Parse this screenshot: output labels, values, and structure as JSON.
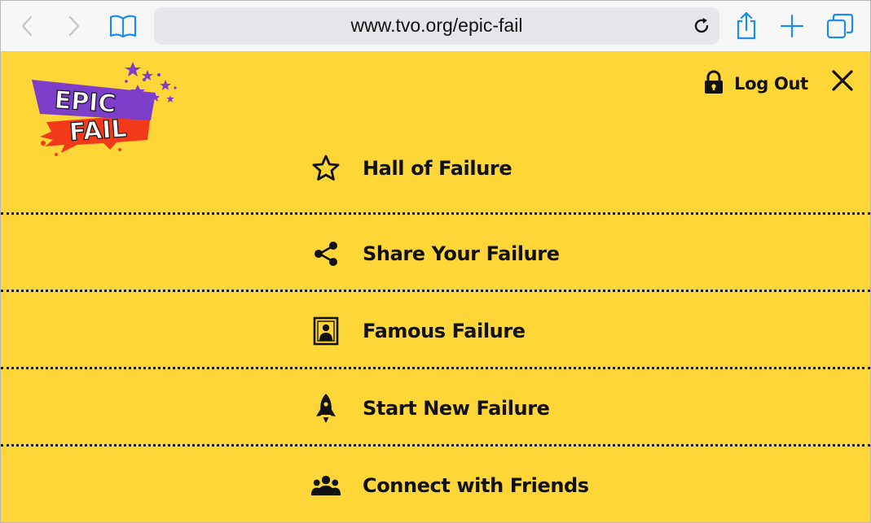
{
  "browser": {
    "url": "www.tvo.org/epic-fail",
    "back_icon": "chevron-left-icon",
    "forward_icon": "chevron-right-icon",
    "bookmarks_icon": "book-icon",
    "reload_icon": "reload-icon",
    "share_icon": "share-icon",
    "new_tab_icon": "plus-icon",
    "tabs_icon": "tabs-icon"
  },
  "header": {
    "logo_line1": "EPIC",
    "logo_line2": "FAIL",
    "logout_label": "Log Out",
    "logout_icon": "lock-icon",
    "close_icon": "close-icon"
  },
  "menu": {
    "items": [
      {
        "label": "Hall of Failure",
        "icon": "star-icon"
      },
      {
        "label": "Share Your Failure",
        "icon": "share-icon"
      },
      {
        "label": "Famous Failure",
        "icon": "portrait-icon"
      },
      {
        "label": "Start New Failure",
        "icon": "rocket-icon"
      },
      {
        "label": "Connect with Friends",
        "icon": "group-icon"
      }
    ]
  },
  "colors": {
    "page_background": "#fed638",
    "toolbar_background": "#f7f7f7",
    "toolbar_accent": "#1a8cf0",
    "logo_purple": "#7d3fc9",
    "logo_red": "#f23a1a",
    "text": "#111111"
  }
}
